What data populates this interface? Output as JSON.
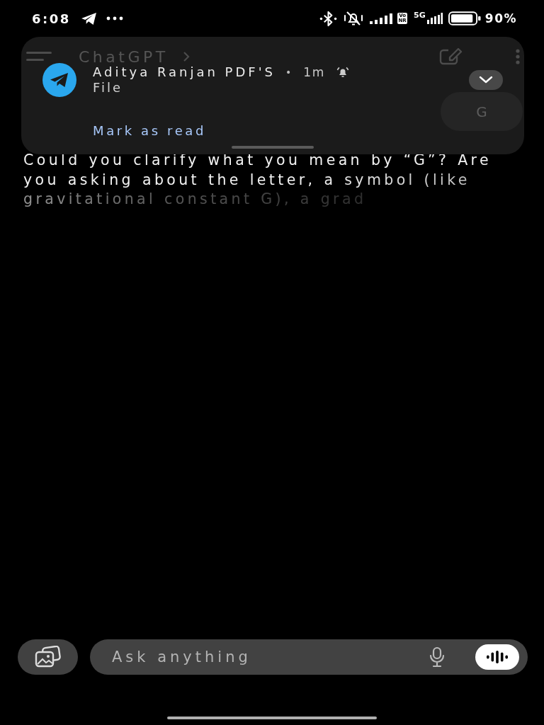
{
  "status_bar": {
    "time": "6:08",
    "vonr_badge": "Vo NR",
    "network": "5G",
    "battery": "90%"
  },
  "app_bar": {
    "title": "ChatGPT"
  },
  "messages": [
    {
      "kind": "user",
      "text": "G"
    },
    {
      "kind": "assistant",
      "text": "Could you clarify what you mean by “G”? Are you asking about the letter, a symbol (like gravitational constant G), a grad",
      "streaming": true
    }
  ],
  "notification": {
    "title": "Aditya Ranjan PDF'S",
    "separator": "•",
    "time": "1m",
    "text": "File",
    "action": "Mark as read",
    "expanded": false
  },
  "composer": {
    "placeholder": "Ask anything"
  }
}
